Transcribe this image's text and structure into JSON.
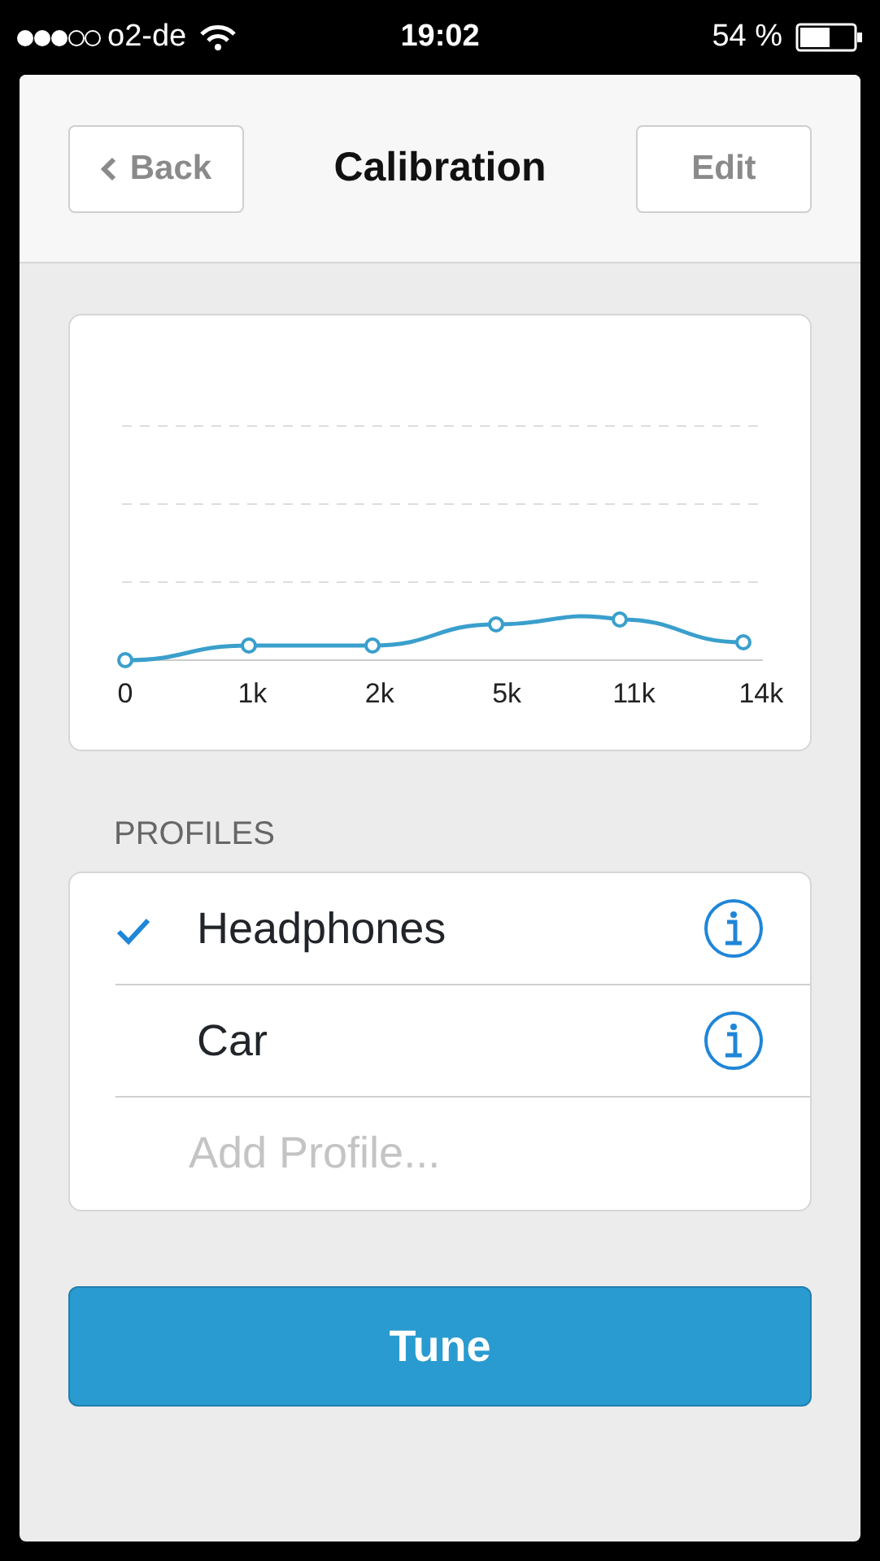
{
  "status_bar": {
    "carrier": "o2-de",
    "time": "19:02",
    "battery": "54 %"
  },
  "nav": {
    "back": "Back",
    "title": "Calibration",
    "edit": "Edit"
  },
  "chart": {
    "x_labels": [
      "0",
      "1k",
      "2k",
      "5k",
      "11k",
      "14k"
    ]
  },
  "profiles": {
    "heading": "PROFILES",
    "items": [
      {
        "kind": "profile",
        "label": "Headphones",
        "selected": true
      },
      {
        "kind": "profile",
        "label": "Car",
        "selected": false
      },
      {
        "kind": "add",
        "placeholder": "Add Profile..."
      }
    ]
  },
  "tune_button": "Tune"
}
